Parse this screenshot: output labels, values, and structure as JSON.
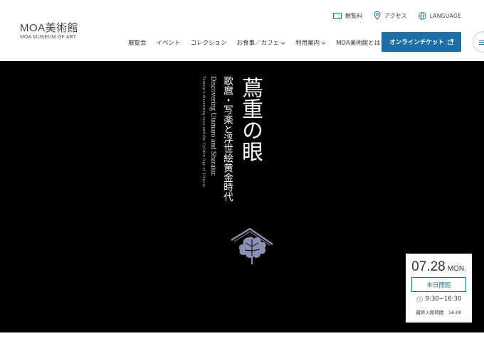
{
  "logo": {
    "main": "MOA美術館",
    "sub": "MOA MUSEUM OF ART"
  },
  "utility": {
    "admission": "観覧料",
    "access": "アクセス",
    "language": "LANGUAGE"
  },
  "nav": {
    "items": [
      {
        "label": "展覧会"
      },
      {
        "label": "イベント"
      },
      {
        "label": "コレクション"
      },
      {
        "label": "お食事／カフェ"
      },
      {
        "label": "利用案内"
      },
      {
        "label": "MOA美術館とは"
      }
    ],
    "ticket": "オンラインチケット"
  },
  "hero": {
    "title": "蔦重の眼",
    "subtitle": "歌麿・写楽と浮世絵黄金時代",
    "en_title": "Discovering Utamaro and Sharaku:",
    "en_subtitle": "Tsutaju's discerning eyes and the Golden Age of Ukiyoe"
  },
  "date_card": {
    "date": "07.28",
    "weekday": "MON.",
    "status": "本日開館",
    "hours": "9:30−16:30",
    "last_entry": "最終入館時間　16:00"
  },
  "colors": {
    "accent": "#1d6fa8",
    "hero_bg": "#000000",
    "crest": "#8c8fb4"
  },
  "icons": {
    "admission": "ticket-icon",
    "access": "map-pin-icon",
    "language": "globe-icon",
    "external": "external-link-icon",
    "clock": "clock-icon",
    "chevron": "chevron-down-icon",
    "menu": "menu-icon"
  }
}
